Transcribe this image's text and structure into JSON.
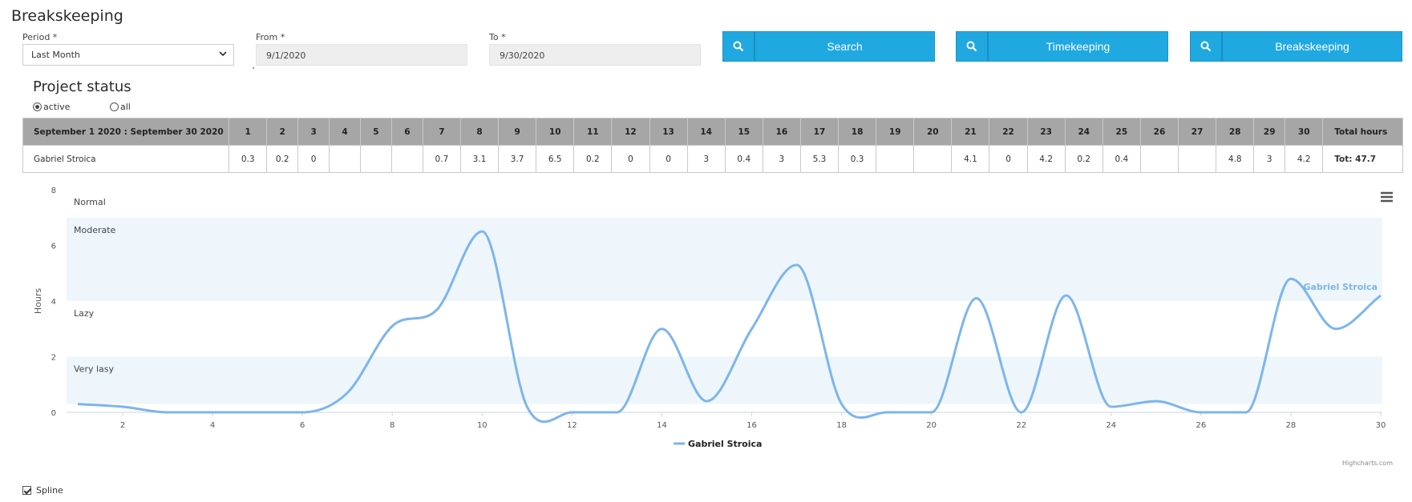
{
  "page": {
    "title": "Breakskeeping"
  },
  "filters": {
    "period_label": "Period *",
    "period_value": "Last Month",
    "from_label": "From *",
    "from_value": "9/1/2020",
    "to_label": "To *",
    "to_value": "9/30/2020"
  },
  "buttons": {
    "search": "Search",
    "timekeeping": "Timekeeping",
    "breakskeeping": "Breakskeeping"
  },
  "project": {
    "title": "Project status",
    "radio_active": "active",
    "radio_all": "all",
    "selected": "active"
  },
  "table": {
    "range_header": "September 1 2020 : September 30 2020",
    "days": [
      "1",
      "2",
      "3",
      "4",
      "5",
      "6",
      "7",
      "8",
      "9",
      "10",
      "11",
      "12",
      "13",
      "14",
      "15",
      "16",
      "17",
      "18",
      "19",
      "20",
      "21",
      "22",
      "23",
      "24",
      "25",
      "26",
      "27",
      "28",
      "29",
      "30"
    ],
    "total_header": "Total hours",
    "rows": [
      {
        "name": "Gabriel Stroica",
        "values": [
          "0.3",
          "0.2",
          "0",
          "",
          "",
          "",
          "0.7",
          "3.1",
          "3.7",
          "6.5",
          "0.2",
          "0",
          "0",
          "3",
          "0.4",
          "3",
          "5.3",
          "0.3",
          "",
          "",
          "4.1",
          "0",
          "4.2",
          "0.2",
          "0.4",
          "",
          "",
          "4.8",
          "3",
          "4.2"
        ],
        "total": "Tot: 47.7"
      }
    ]
  },
  "chart_data": {
    "type": "line",
    "smoothing": "spline",
    "title": "",
    "xlabel": "",
    "ylabel": "Hours",
    "xlim": [
      1,
      30
    ],
    "ylim": [
      0,
      8
    ],
    "x_ticks": [
      2,
      4,
      6,
      8,
      10,
      12,
      14,
      16,
      18,
      20,
      22,
      24,
      26,
      28,
      30
    ],
    "y_ticks": [
      0,
      2,
      4,
      6,
      8
    ],
    "x": [
      1,
      2,
      3,
      4,
      5,
      6,
      7,
      8,
      9,
      10,
      11,
      12,
      13,
      14,
      15,
      16,
      17,
      18,
      19,
      20,
      21,
      22,
      23,
      24,
      25,
      26,
      27,
      28,
      29,
      30
    ],
    "series": [
      {
        "name": "Gabriel Stroica",
        "color": "#7cb5ec",
        "values": [
          0.3,
          0.2,
          0,
          0,
          0,
          0,
          0.7,
          3.1,
          3.7,
          6.5,
          0.2,
          0,
          0,
          3,
          0.4,
          3,
          5.3,
          0.3,
          0,
          0,
          4.1,
          0,
          4.2,
          0.2,
          0.4,
          0,
          0,
          4.8,
          3,
          4.2
        ]
      }
    ],
    "plot_bands": [
      {
        "from": 0.3,
        "to": 2,
        "label": "Very lasy",
        "color": "#eef6fc"
      },
      {
        "from": 2,
        "to": 4,
        "label": "Lazy",
        "color": "#ffffff"
      },
      {
        "from": 4,
        "to": 7,
        "label": "Moderate",
        "color": "#eef6fc"
      },
      {
        "from": 7,
        "to": 8,
        "label": "Normal",
        "color": "#ffffff"
      }
    ],
    "legend": {
      "position": "bottom-center",
      "label": "Gabriel Stroica"
    },
    "credits": "Highcharts.com",
    "grid": false
  },
  "options": {
    "spline_label": "Spline",
    "spline_checked": true
  },
  "colors": {
    "accent": "#20a8e0",
    "series": "#7cb5ec",
    "table_header": "#a6a6a6"
  }
}
